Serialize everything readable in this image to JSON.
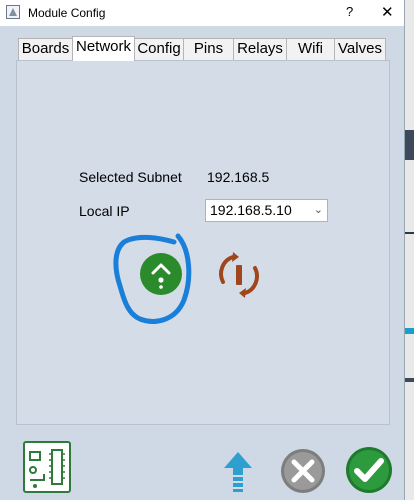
{
  "window": {
    "title": "Module Config",
    "help": "?",
    "close": "✕"
  },
  "tabs": [
    {
      "label": "Boards"
    },
    {
      "label": "Network"
    },
    {
      "label": "Config"
    },
    {
      "label": "Pins"
    },
    {
      "label": "Relays"
    },
    {
      "label": "Wifi"
    },
    {
      "label": "Valves"
    }
  ],
  "active_tab": "Network",
  "network": {
    "subnet_label": "Selected Subnet",
    "subnet_value": "192.168.5",
    "local_ip_label": "Local IP",
    "local_ip_value": "192.168.5.10"
  },
  "icons": {
    "upload": "upload-circle-icon",
    "refresh": "refresh-icon",
    "board": "circuit-board-icon",
    "arrow_up": "arrow-up-icon",
    "cancel": "cancel-icon",
    "confirm": "confirm-icon"
  },
  "colors": {
    "green": "#2b8a2b",
    "refresh": "#a0461c",
    "blue_annotation": "#1a7fd8",
    "arrow": "#2ea0d0",
    "panel": "#d3dce7"
  }
}
